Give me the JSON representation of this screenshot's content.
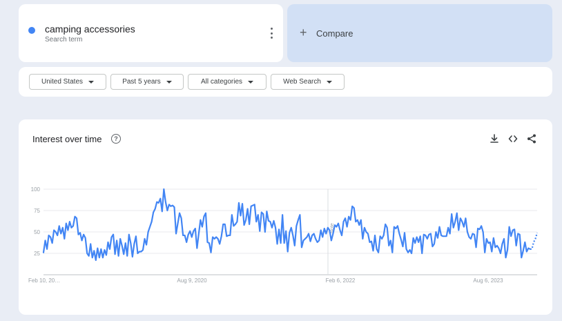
{
  "search_term": {
    "name": "camping accessories",
    "subtitle": "Search term",
    "color": "#4285f4"
  },
  "compare": {
    "plus": "+",
    "label": "Compare"
  },
  "filters": [
    {
      "label": "United States"
    },
    {
      "label": "Past 5 years"
    },
    {
      "label": "All categories"
    },
    {
      "label": "Web Search"
    }
  ],
  "chart": {
    "title": "Interest over time",
    "help_icon": "?",
    "icons": [
      "download-icon",
      "embed-code-icon",
      "share-icon"
    ],
    "note_label": "Note"
  },
  "chart_data": {
    "type": "line",
    "series": [
      {
        "color": "#4285f4",
        "values": [
          26,
          40,
          30,
          46,
          44,
          37,
          52,
          50,
          46,
          57,
          48,
          55,
          42,
          60,
          52,
          62,
          55,
          57,
          68,
          66,
          47,
          49,
          40,
          47,
          43,
          25,
          22,
          36,
          20,
          28,
          17,
          31,
          20,
          30,
          20,
          29,
          23,
          38,
          30,
          44,
          47,
          24,
          40,
          22,
          42,
          34,
          24,
          37,
          22,
          47,
          37,
          21,
          36,
          45,
          25,
          27,
          27,
          29,
          42,
          35,
          50,
          56,
          62,
          73,
          77,
          85,
          84,
          89,
          74,
          100,
          85,
          75,
          82,
          80,
          81,
          79,
          48,
          60,
          72,
          66,
          46,
          46,
          38,
          47,
          51,
          44,
          51,
          54,
          31,
          48,
          64,
          56,
          68,
          72,
          38,
          37,
          26,
          44,
          42,
          44,
          42,
          36,
          45,
          59,
          59,
          45,
          46,
          46,
          70,
          57,
          59,
          62,
          84,
          69,
          83,
          58,
          64,
          77,
          59,
          80,
          81,
          82,
          62,
          70,
          51,
          73,
          71,
          50,
          74,
          63,
          62,
          55,
          63,
          55,
          36,
          53,
          37,
          70,
          37,
          51,
          27,
          49,
          55,
          46,
          34,
          57,
          64,
          70,
          32,
          40,
          42,
          44,
          48,
          39,
          46,
          48,
          42,
          38,
          40,
          52,
          44,
          54,
          48,
          55,
          52,
          40,
          48,
          58,
          56,
          60,
          52,
          46,
          62,
          66,
          56,
          68,
          64,
          80,
          78,
          62,
          64,
          58,
          64,
          42,
          55,
          50,
          48,
          38,
          39,
          28,
          46,
          30,
          26,
          45,
          42,
          46,
          59,
          55,
          34,
          40,
          26,
          56,
          54,
          57,
          48,
          41,
          33,
          49,
          30,
          26,
          29,
          25,
          43,
          37,
          44,
          38,
          45,
          25,
          47,
          46,
          42,
          47,
          48,
          33,
          36,
          50,
          43,
          56,
          46,
          45,
          45,
          45,
          55,
          48,
          71,
          55,
          62,
          72,
          52,
          66,
          62,
          56,
          66,
          50,
          44,
          42,
          48,
          47,
          32,
          54,
          53,
          57,
          50,
          26,
          42,
          37,
          38,
          27,
          43,
          32,
          34,
          31,
          25,
          36,
          42,
          20,
          29,
          56,
          45,
          52,
          53,
          34,
          48,
          47,
          20,
          28,
          38,
          27,
          31,
          30
        ]
      }
    ],
    "partial_tail": [
      30,
      38,
      42,
      49
    ],
    "x_tick_labels": [
      "Feb 10, 20…",
      "Aug 9, 2020",
      "Feb 6, 2022",
      "Aug 6, 2023"
    ],
    "y_tick_labels": [
      "100",
      "75",
      "50",
      "25"
    ],
    "ylim": [
      0,
      100
    ],
    "grid": true
  }
}
